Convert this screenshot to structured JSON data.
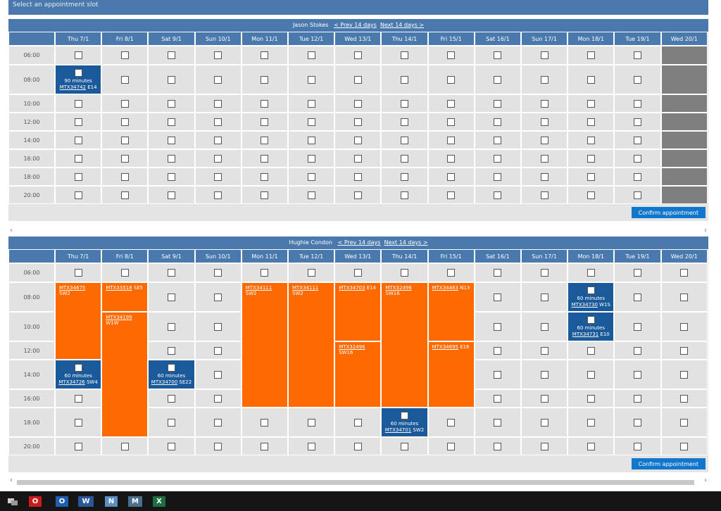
{
  "page": {
    "title": "Select an appointment slot"
  },
  "days": [
    "Thu 7/1",
    "Fri 8/1",
    "Sat 9/1",
    "Sun 10/1",
    "Mon 11/1",
    "Tue 12/1",
    "Wed 13/1",
    "Thu 14/1",
    "Fri 15/1",
    "Sat 16/1",
    "Sun 17/1",
    "Mon 18/1",
    "Tue 19/1",
    "Wed 20/1"
  ],
  "times": [
    "06:00",
    "08:00",
    "10:00",
    "12:00",
    "14:00",
    "16:00",
    "18:00",
    "20:00"
  ],
  "nav": {
    "prev": "< Prev 14 days",
    "next": "Next 14 days >"
  },
  "confirm_label": "Confirm appointment",
  "calendars": [
    {
      "name": "Jason Stokes",
      "disabled_days": [
        13
      ],
      "bookings": [
        {
          "day": 0,
          "time": 1,
          "duration": "90 minutes",
          "code": "MTX34742",
          "area": "E14"
        }
      ],
      "busy": []
    },
    {
      "name": "Hughie Condon",
      "disabled_days": [],
      "bookings": [
        {
          "day": 0,
          "time": 4,
          "duration": "60 minutes",
          "code": "MTX34726",
          "area": "SW4"
        },
        {
          "day": 2,
          "time": 4,
          "duration": "60 minutes",
          "code": "MTX34700",
          "area": "SE22"
        },
        {
          "day": 7,
          "time": 6,
          "duration": "60 minutes",
          "code": "MTX34701",
          "area": "SW2"
        },
        {
          "day": 11,
          "time": 1,
          "duration": "60 minutes",
          "code": "MTX34730",
          "area": "W1S"
        },
        {
          "day": 11,
          "time": 2,
          "duration": "60 minutes",
          "code": "MTX34731",
          "area": "E10"
        }
      ],
      "busy": [
        {
          "day": 0,
          "start": 1,
          "end": 4,
          "code": "MTX34675",
          "area": "SW2"
        },
        {
          "day": 1,
          "start": 1,
          "end": 2,
          "code": "MTX33518",
          "area": "SE5"
        },
        {
          "day": 1,
          "start": 2,
          "end": 7,
          "code": "MTX34199",
          "area": "W1W"
        },
        {
          "day": 4,
          "start": 1,
          "end": 6,
          "code": "MTX34111",
          "area": "SW2"
        },
        {
          "day": 5,
          "start": 1,
          "end": 6,
          "code": "MTX34111",
          "area": "SW2"
        },
        {
          "day": 6,
          "start": 1,
          "end": 3,
          "code": "MTX34703",
          "area": "E14"
        },
        {
          "day": 6,
          "start": 3,
          "end": 6,
          "code": "MTX32496",
          "area": "SW16"
        },
        {
          "day": 7,
          "start": 1,
          "end": 6,
          "code": "MTX32496",
          "area": "SW16"
        },
        {
          "day": 8,
          "start": 1,
          "end": 3,
          "code": "MTX34463",
          "area": "N13"
        },
        {
          "day": 8,
          "start": 3,
          "end": 6,
          "code": "MTX34695",
          "area": "E16"
        }
      ]
    }
  ],
  "taskbar": [
    {
      "name": "network-icon"
    },
    {
      "name": "opera-icon",
      "label": "O",
      "color": "#cc1b1b"
    },
    {
      "name": "outlook-icon",
      "label": "O",
      "color": "#1f5fb0"
    },
    {
      "name": "word-icon",
      "label": "W",
      "color": "#2b579a"
    },
    {
      "name": "notes-icon",
      "label": "N",
      "color": "#5a8fbf"
    },
    {
      "name": "media-icon",
      "label": "M",
      "color": "#4d6f8f"
    },
    {
      "name": "excel-icon",
      "label": "X",
      "color": "#1d6f42"
    }
  ]
}
